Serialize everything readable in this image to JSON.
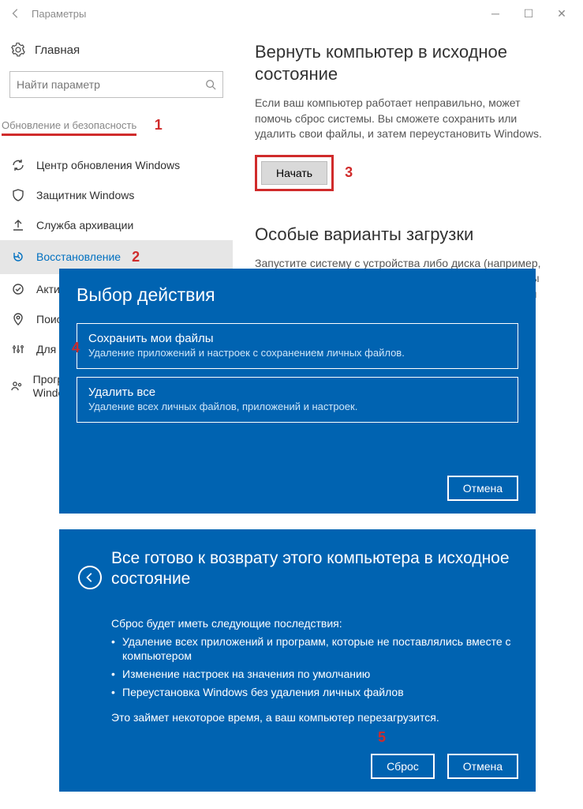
{
  "window": {
    "title": "Параметры"
  },
  "sidebar": {
    "home": "Главная",
    "search_placeholder": "Найти параметр",
    "section": "Обновление и безопасность",
    "items": [
      {
        "label": "Центр обновления Windows"
      },
      {
        "label": "Защитник Windows"
      },
      {
        "label": "Служба архивации"
      },
      {
        "label": "Восстановление"
      },
      {
        "label": "Активация"
      },
      {
        "label": "Поиск устройства"
      },
      {
        "label": "Для разработчиков"
      },
      {
        "label": "Программа предварительной оценки Windows"
      }
    ]
  },
  "markers": {
    "m1": "1",
    "m2": "2",
    "m3": "3",
    "m4": "4",
    "m5": "5"
  },
  "main": {
    "reset_title": "Вернуть компьютер в исходное состояние",
    "reset_desc": "Если ваш компьютер работает неправильно, может помочь сброс системы. Вы сможете сохранить или удалить свои файлы, и затем переустановить Windows.",
    "start_btn": "Начать",
    "advanced_title": "Особые варианты загрузки",
    "advanced_desc": "Запустите систему с устройства либо диска (например, USB-накопителя или DVD-диска), измените параметры загрузки Windows или восстановите ее из образа. Ваш компьютер"
  },
  "choice_dialog": {
    "title": "Выбор действия",
    "options": [
      {
        "title": "Сохранить мои файлы",
        "desc": "Удаление приложений и настроек с сохранением личных файлов."
      },
      {
        "title": "Удалить все",
        "desc": "Удаление всех личных файлов, приложений и настроек."
      }
    ],
    "cancel": "Отмена"
  },
  "ready_dialog": {
    "title": "Все готово к возврату этого компьютера в исходное состояние",
    "lead": "Сброс будет иметь следующие последствия:",
    "bullets": [
      "Удаление всех приложений и программ, которые не поставлялись вместе с компьютером",
      "Изменение настроек на значения по умолчанию",
      "Переустановка Windows без удаления личных файлов"
    ],
    "note": "Это займет некоторое время, а ваш компьютер перезагрузится.",
    "reset": "Сброс",
    "cancel": "Отмена"
  }
}
